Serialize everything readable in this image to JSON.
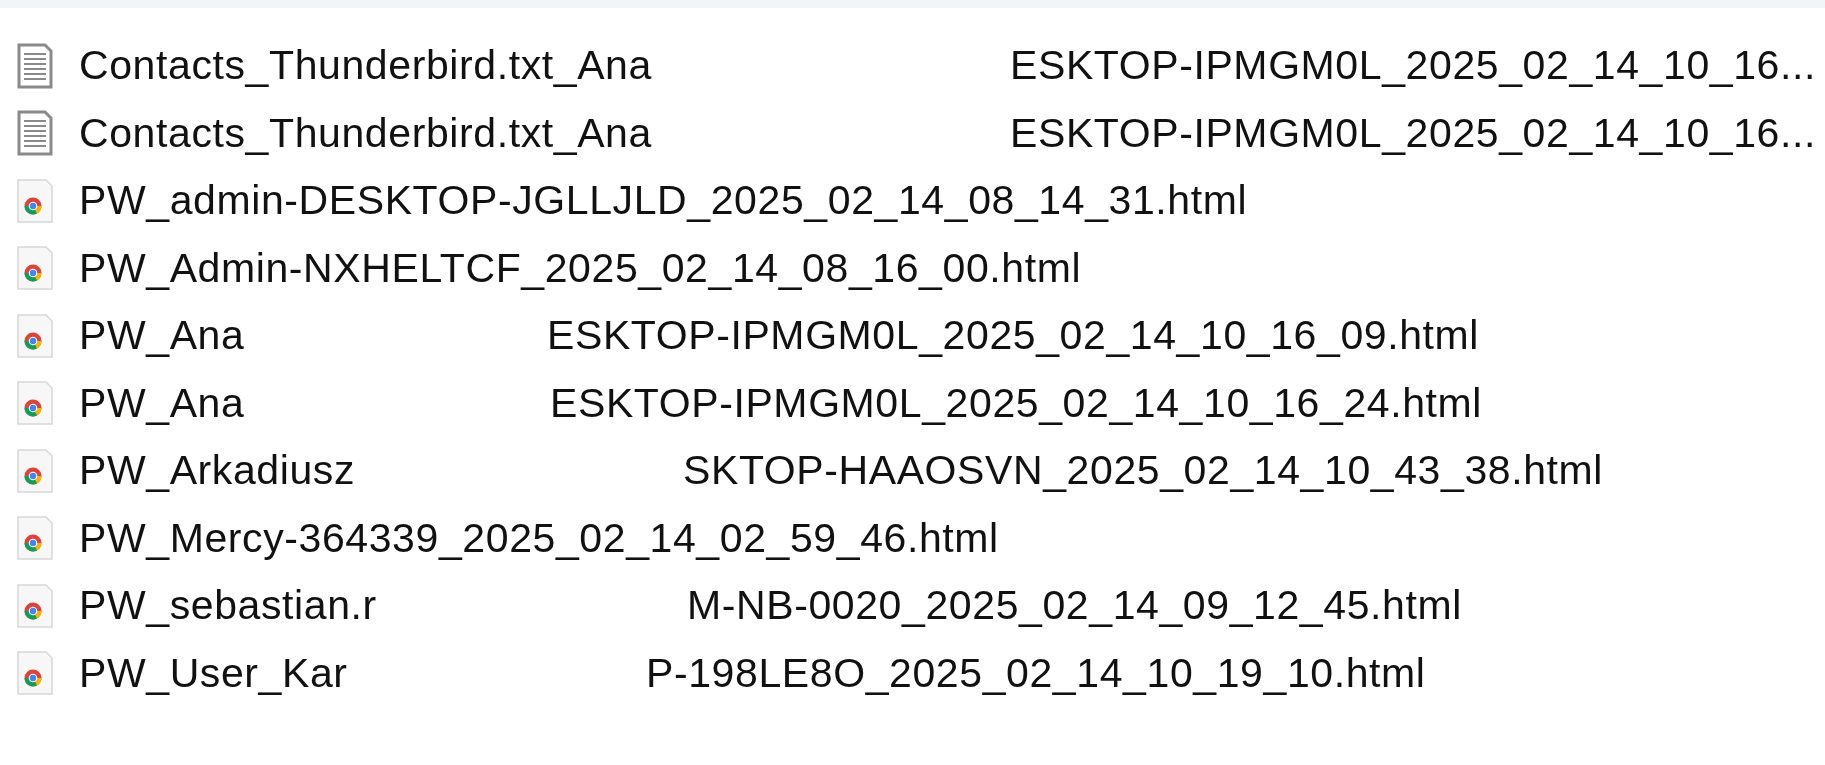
{
  "files": [
    {
      "kind": "text",
      "name_start": "Contacts_Thunderbird.txt_Ana",
      "name_end": "ESKTOP-IPMGM0L_2025_02_14_10_16..."
    },
    {
      "kind": "text",
      "name_start": "Contacts_Thunderbird.txt_Ana",
      "name_end": "ESKTOP-IPMGM0L_2025_02_14_10_16..."
    },
    {
      "kind": "web",
      "name_start": "PW_admin-DESKTOP-JGLLJLD_2025_02_14_08_14_31.html"
    },
    {
      "kind": "web",
      "name_start": "PW_Admin-NXHELTCF_2025_02_14_08_16_00.html"
    },
    {
      "kind": "web",
      "name_start": "PW_Ana",
      "name_end": "ESKTOP-IPMGM0L_2025_02_14_10_16_09.html"
    },
    {
      "kind": "web",
      "name_start": "PW_Ana",
      "name_end": "ESKTOP-IPMGM0L_2025_02_14_10_16_24.html"
    },
    {
      "kind": "web",
      "name_start": "PW_Arkadiusz",
      "name_end": "SKTOP-HAAOSVN_2025_02_14_10_43_38.html"
    },
    {
      "kind": "web",
      "name_start": "PW_Mercy-364339_2025_02_14_02_59_46.html"
    },
    {
      "kind": "web",
      "name_start": "PW_sebastian.r",
      "name_end": "M-NB-0020_2025_02_14_09_12_45.html"
    },
    {
      "kind": "web",
      "name_start": "PW_User_Kar",
      "name_end": "P-198LE8O_2025_02_14_10_19_10.html"
    }
  ]
}
